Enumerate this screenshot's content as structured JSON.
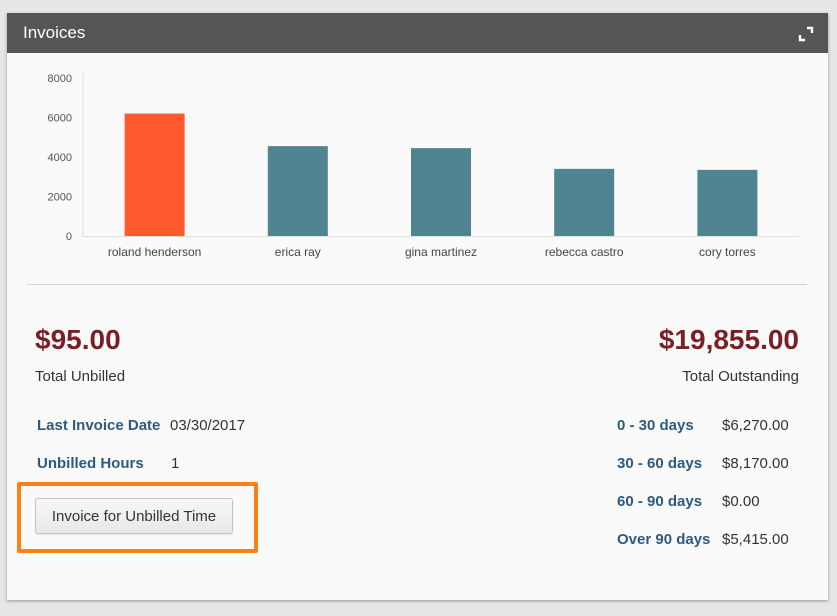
{
  "panel": {
    "title": "Invoices",
    "expand_icon": "expand-icon"
  },
  "chart_data": {
    "type": "bar",
    "categories": [
      "roland henderson",
      "erica ray",
      "gina martinez",
      "rebecca castro",
      "cory torres"
    ],
    "values": [
      6200,
      4550,
      4450,
      3400,
      3350
    ],
    "colors": [
      "#ff5a2e",
      "#4f8490",
      "#4f8490",
      "#4f8490",
      "#4f8490"
    ],
    "yticks": [
      "0",
      "2000",
      "4000",
      "6000",
      "8000"
    ],
    "ylim": [
      0,
      8000
    ],
    "grid": false,
    "legend": "none",
    "title": "",
    "xlabel": "",
    "ylabel": ""
  },
  "summary": {
    "unbilled_amount": "$95.00",
    "unbilled_caption": "Total Unbilled",
    "outstanding_amount": "$19,855.00",
    "outstanding_caption": "Total Outstanding"
  },
  "details": {
    "last_invoice_label": "Last Invoice Date",
    "last_invoice_value": "03/30/2017",
    "unbilled_hours_label": "Unbilled Hours",
    "unbilled_hours_value": "1"
  },
  "actions": {
    "invoice_button": "Invoice for Unbilled Time"
  },
  "aging": [
    {
      "label": "0 - 30 days",
      "value": "$6,270.00"
    },
    {
      "label": "30 - 60 days",
      "value": "$8,170.00"
    },
    {
      "label": "60 - 90 days",
      "value": "$0.00"
    },
    {
      "label": "Over 90 days",
      "value": "$5,415.00"
    }
  ],
  "colors": {
    "amount": "#7a1f24",
    "link": "#2e5a7f",
    "header": "#555555",
    "highlight": "#ff8012"
  }
}
